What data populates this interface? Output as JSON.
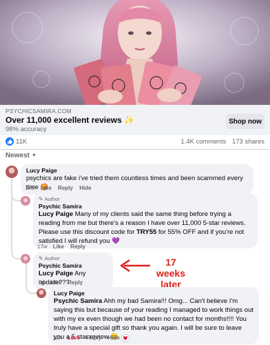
{
  "ad": {
    "domain": "PSYCHICSAMIRA.COM",
    "headline": "Over 11,000 excellent reviews",
    "headline_emoji": "✨",
    "subtext": "98% accuracy",
    "cta": "Shop now"
  },
  "reactions": {
    "likes": "11K",
    "comments": "1.4K comments",
    "shares": "173 shares"
  },
  "sort_label": "Newest",
  "comments": [
    {
      "name": "Lucy Paige",
      "text": "psychics are fake i've tried them countless times and been scammed every time",
      "emoji": "😡",
      "time": "17w",
      "actions": [
        "Like",
        "Reply",
        "Hide"
      ]
    },
    {
      "badge": "Author",
      "name": "Psychic Samira",
      "mention": "Lucy Paige",
      "text_before_code": " Many of my clients said the same thing before trying a reading from me but there's a reason I have over 11,000 5-star reviews. Please use this discount code for ",
      "code": "TRY55",
      "text_after_code": " for 55% OFF and if you're not satisfied I will refund you",
      "emoji": "💜",
      "time": "17w",
      "actions": [
        "Like",
        "Reply"
      ]
    },
    {
      "badge": "Author",
      "name": "Psychic Samira",
      "mention": "Lucy Paige",
      "text": " Any update???",
      "time": "3d",
      "actions": [
        "Like",
        "Reply"
      ]
    },
    {
      "name": "Lucy Paige",
      "mention": "Psychic Samira",
      "text": " Ahh my bad Samira!!! Omg... Can't believe I'm saying this but because of your reading I managed to work things out with my ex even though we had been no contact for months!!!! You truly have a special gift so thank you again. I will be sure to leave you a 5 star review",
      "emoji": "😊",
      "time": "12h",
      "actions": [
        "Love",
        "Reply",
        "Hide"
      ]
    }
  ],
  "annotation": {
    "line1": "17 weeks",
    "line2": "later",
    "color": "#e0201a"
  },
  "colors": {
    "link_blue": "#1877f2",
    "bubble": "#f0f2f5",
    "secondary_text": "#65676b"
  }
}
